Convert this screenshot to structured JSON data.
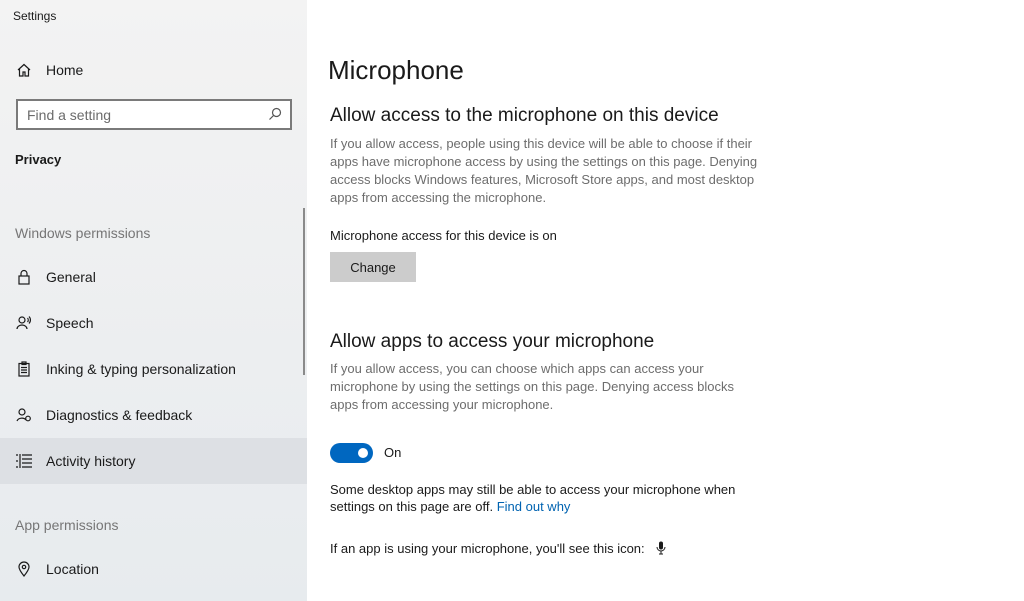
{
  "window": {
    "title": "Settings"
  },
  "sidebar": {
    "home_label": "Home",
    "search_placeholder": "Find a setting",
    "section": "Privacy",
    "windows_permissions_header": "Windows permissions",
    "items": [
      {
        "label": "General",
        "icon": "lock-icon"
      },
      {
        "label": "Speech",
        "icon": "speech-icon"
      },
      {
        "label": "Inking & typing personalization",
        "icon": "clipboard-icon"
      },
      {
        "label": "Diagnostics & feedback",
        "icon": "diagnostics-icon"
      },
      {
        "label": "Activity history",
        "icon": "activity-history-icon",
        "active": true
      }
    ],
    "app_permissions_header": "App permissions",
    "app_items": [
      {
        "label": "Location",
        "icon": "location-icon"
      }
    ]
  },
  "main": {
    "title": "Microphone",
    "device_section": {
      "heading": "Allow access to the microphone on this device",
      "description": "If you allow access, people using this device will be able to choose if their apps have microphone access by using the settings on this page. Denying access blocks Windows features, Microsoft Store apps, and most desktop apps from accessing the microphone.",
      "status": "Microphone access for this device is on",
      "change_button": "Change"
    },
    "apps_section": {
      "heading": "Allow apps to access your microphone",
      "description": "If you allow access, you can choose which apps can access your microphone by using the settings on this page. Denying access blocks apps from accessing your microphone.",
      "toggle_label": "On",
      "toggle_state": true,
      "note_text": "Some desktop apps may still be able to access your microphone when settings on this page are off.",
      "note_link": "Find out why",
      "icon_note": "If an app is using your microphone, you'll see this icon:"
    }
  },
  "colors": {
    "accent": "#0067c0",
    "link": "#0063b1",
    "active_bg": "#dde0e4"
  }
}
